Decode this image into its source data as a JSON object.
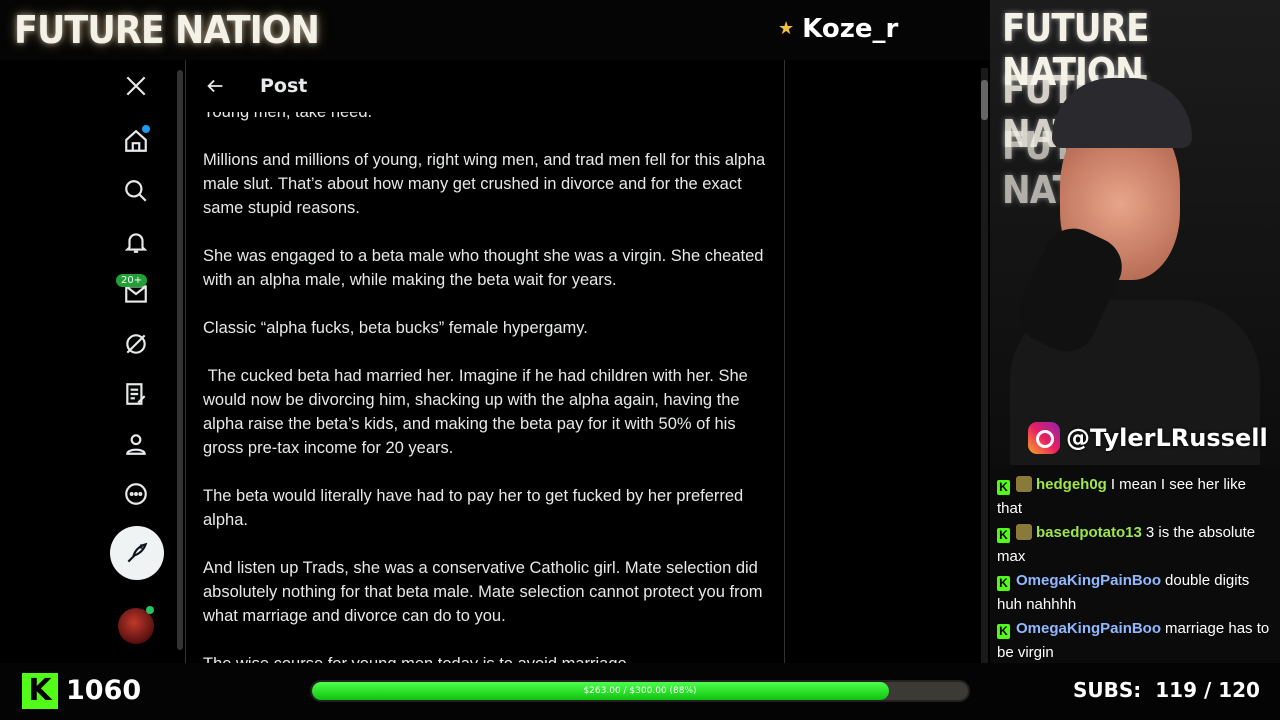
{
  "stream": {
    "logo": "FUTURE NATION",
    "streamer_name": "Koze_r",
    "instagram_handle": "@TylerLRussell",
    "follower_count": "1060",
    "goal_label": "$263.00 / $300.00 (88%)",
    "goal_fraction": 0.88,
    "subs_label": "SUBS:",
    "subs_value": "119 / 120"
  },
  "post": {
    "title": "Post",
    "paragraphs": [
      "Young men, take heed.",
      "Millions and millions of young, right wing men, and trad men fell for this alpha male slut. That’s about how many get crushed in divorce and for the exact same stupid reasons.",
      "She was engaged to a beta male who thought she was a virgin. She cheated with an alpha male, while making the beta wait for years.",
      "Classic “alpha fucks, beta bucks” female hypergamy.",
      " The cucked beta had married her. Imagine if he had children with her. She would now be divorcing him, shacking up with the alpha again, having the alpha raise the beta’s kids, and making the beta pay for it with 50% of his gross pre-tax income for 20 years.",
      "The beta would literally have had to pay her to get fucked by her preferred alpha.",
      "And listen up Trads, she was a conservative Catholic girl. Mate selection did absolutely nothing for that beta male. Mate selection cannot protect you from what marriage and divorce can do to you.",
      "The wise course for young men today is to avoid marriage."
    ]
  },
  "sidebar": {
    "messages_badge": "20+"
  },
  "chat": [
    {
      "user": "hedgeh0g",
      "color": "#9ee64a",
      "text": "I mean I see her like that",
      "emote": true
    },
    {
      "user": "basedpotato13",
      "color": "#9ee64a",
      "text": "3 is the absolute max",
      "emote": true
    },
    {
      "user": "OmegaKingPainBoo",
      "color": "#8fb8ff",
      "text": "double digits huh nahhhh",
      "emote": false
    },
    {
      "user": "OmegaKingPainBoo",
      "color": "#8fb8ff",
      "text": "marriage has to be virgin",
      "emote": false
    }
  ]
}
